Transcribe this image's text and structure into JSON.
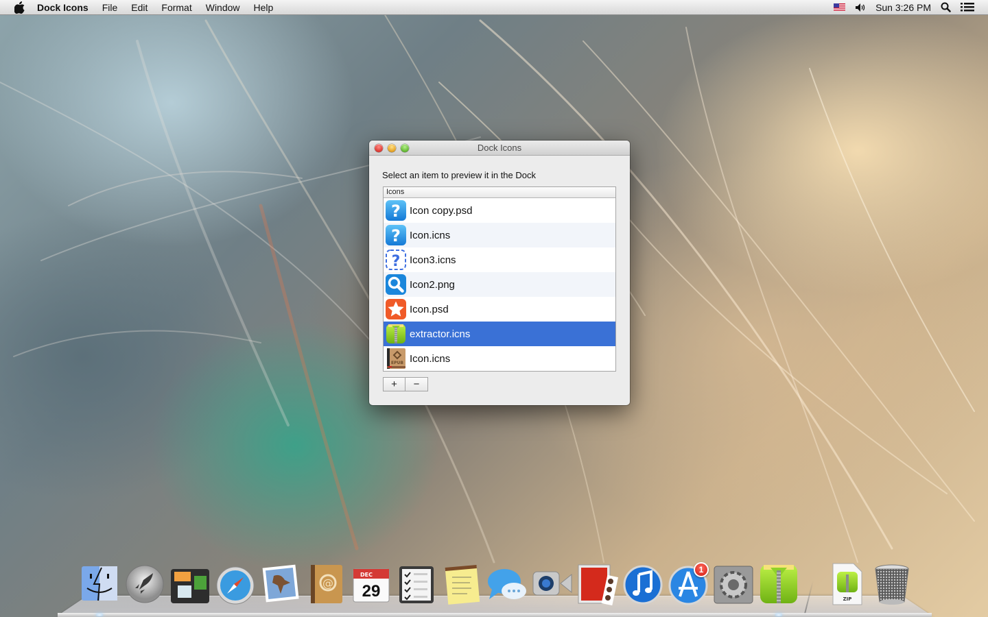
{
  "menubar": {
    "apple_icon": "apple-logo-icon",
    "app_name": "Dock Icons",
    "menus": [
      "File",
      "Edit",
      "Format",
      "Window",
      "Help"
    ],
    "status": {
      "input_source_icon": "us-flag-icon",
      "volume_icon": "speaker-icon",
      "clock": "Sun 3:26 PM",
      "spotlight_icon": "magnifier-icon",
      "notification_icon": "list-icon"
    }
  },
  "window": {
    "title": "Dock Icons",
    "instruction": "Select an item to preview it in the Dock",
    "table": {
      "column_header": "Icons",
      "rows": [
        {
          "label": "Icon copy.psd",
          "icon": "question-mark-icon",
          "selected": false
        },
        {
          "label": "Icon.icns",
          "icon": "question-mark-icon",
          "selected": false
        },
        {
          "label": "Icon3.icns",
          "icon": "dashed-question-mark-icon",
          "selected": false
        },
        {
          "label": "Icon2.png",
          "icon": "magnifier-icon",
          "selected": false
        },
        {
          "label": "Icon.psd",
          "icon": "star-icon",
          "selected": false
        },
        {
          "label": "extractor.icns",
          "icon": "zip-extractor-icon",
          "selected": true
        },
        {
          "label": "Icon.icns",
          "icon": "epub-book-icon",
          "selected": false
        }
      ]
    },
    "add_label": "+",
    "remove_label": "−",
    "selection_color": "#3a71d6"
  },
  "dock": {
    "items": [
      {
        "name": "Finder",
        "running": true
      },
      {
        "name": "Launchpad",
        "running": false
      },
      {
        "name": "Mission Control",
        "running": false
      },
      {
        "name": "Safari",
        "running": false
      },
      {
        "name": "Mail",
        "running": false
      },
      {
        "name": "Contacts",
        "running": false
      },
      {
        "name": "Calendar",
        "running": false,
        "month": "DEC",
        "day": "29"
      },
      {
        "name": "Reminders",
        "running": false
      },
      {
        "name": "Notes",
        "running": false
      },
      {
        "name": "Messages",
        "running": false
      },
      {
        "name": "FaceTime",
        "running": false
      },
      {
        "name": "Photo Booth",
        "running": false
      },
      {
        "name": "iTunes",
        "running": false
      },
      {
        "name": "App Store",
        "running": false,
        "badge": "1"
      },
      {
        "name": "System Preferences",
        "running": false
      },
      {
        "name": "Extractor",
        "running": true
      },
      {
        "name": "ZIP Archive",
        "running": false,
        "label": "ZIP"
      },
      {
        "name": "Trash",
        "running": false
      }
    ]
  }
}
